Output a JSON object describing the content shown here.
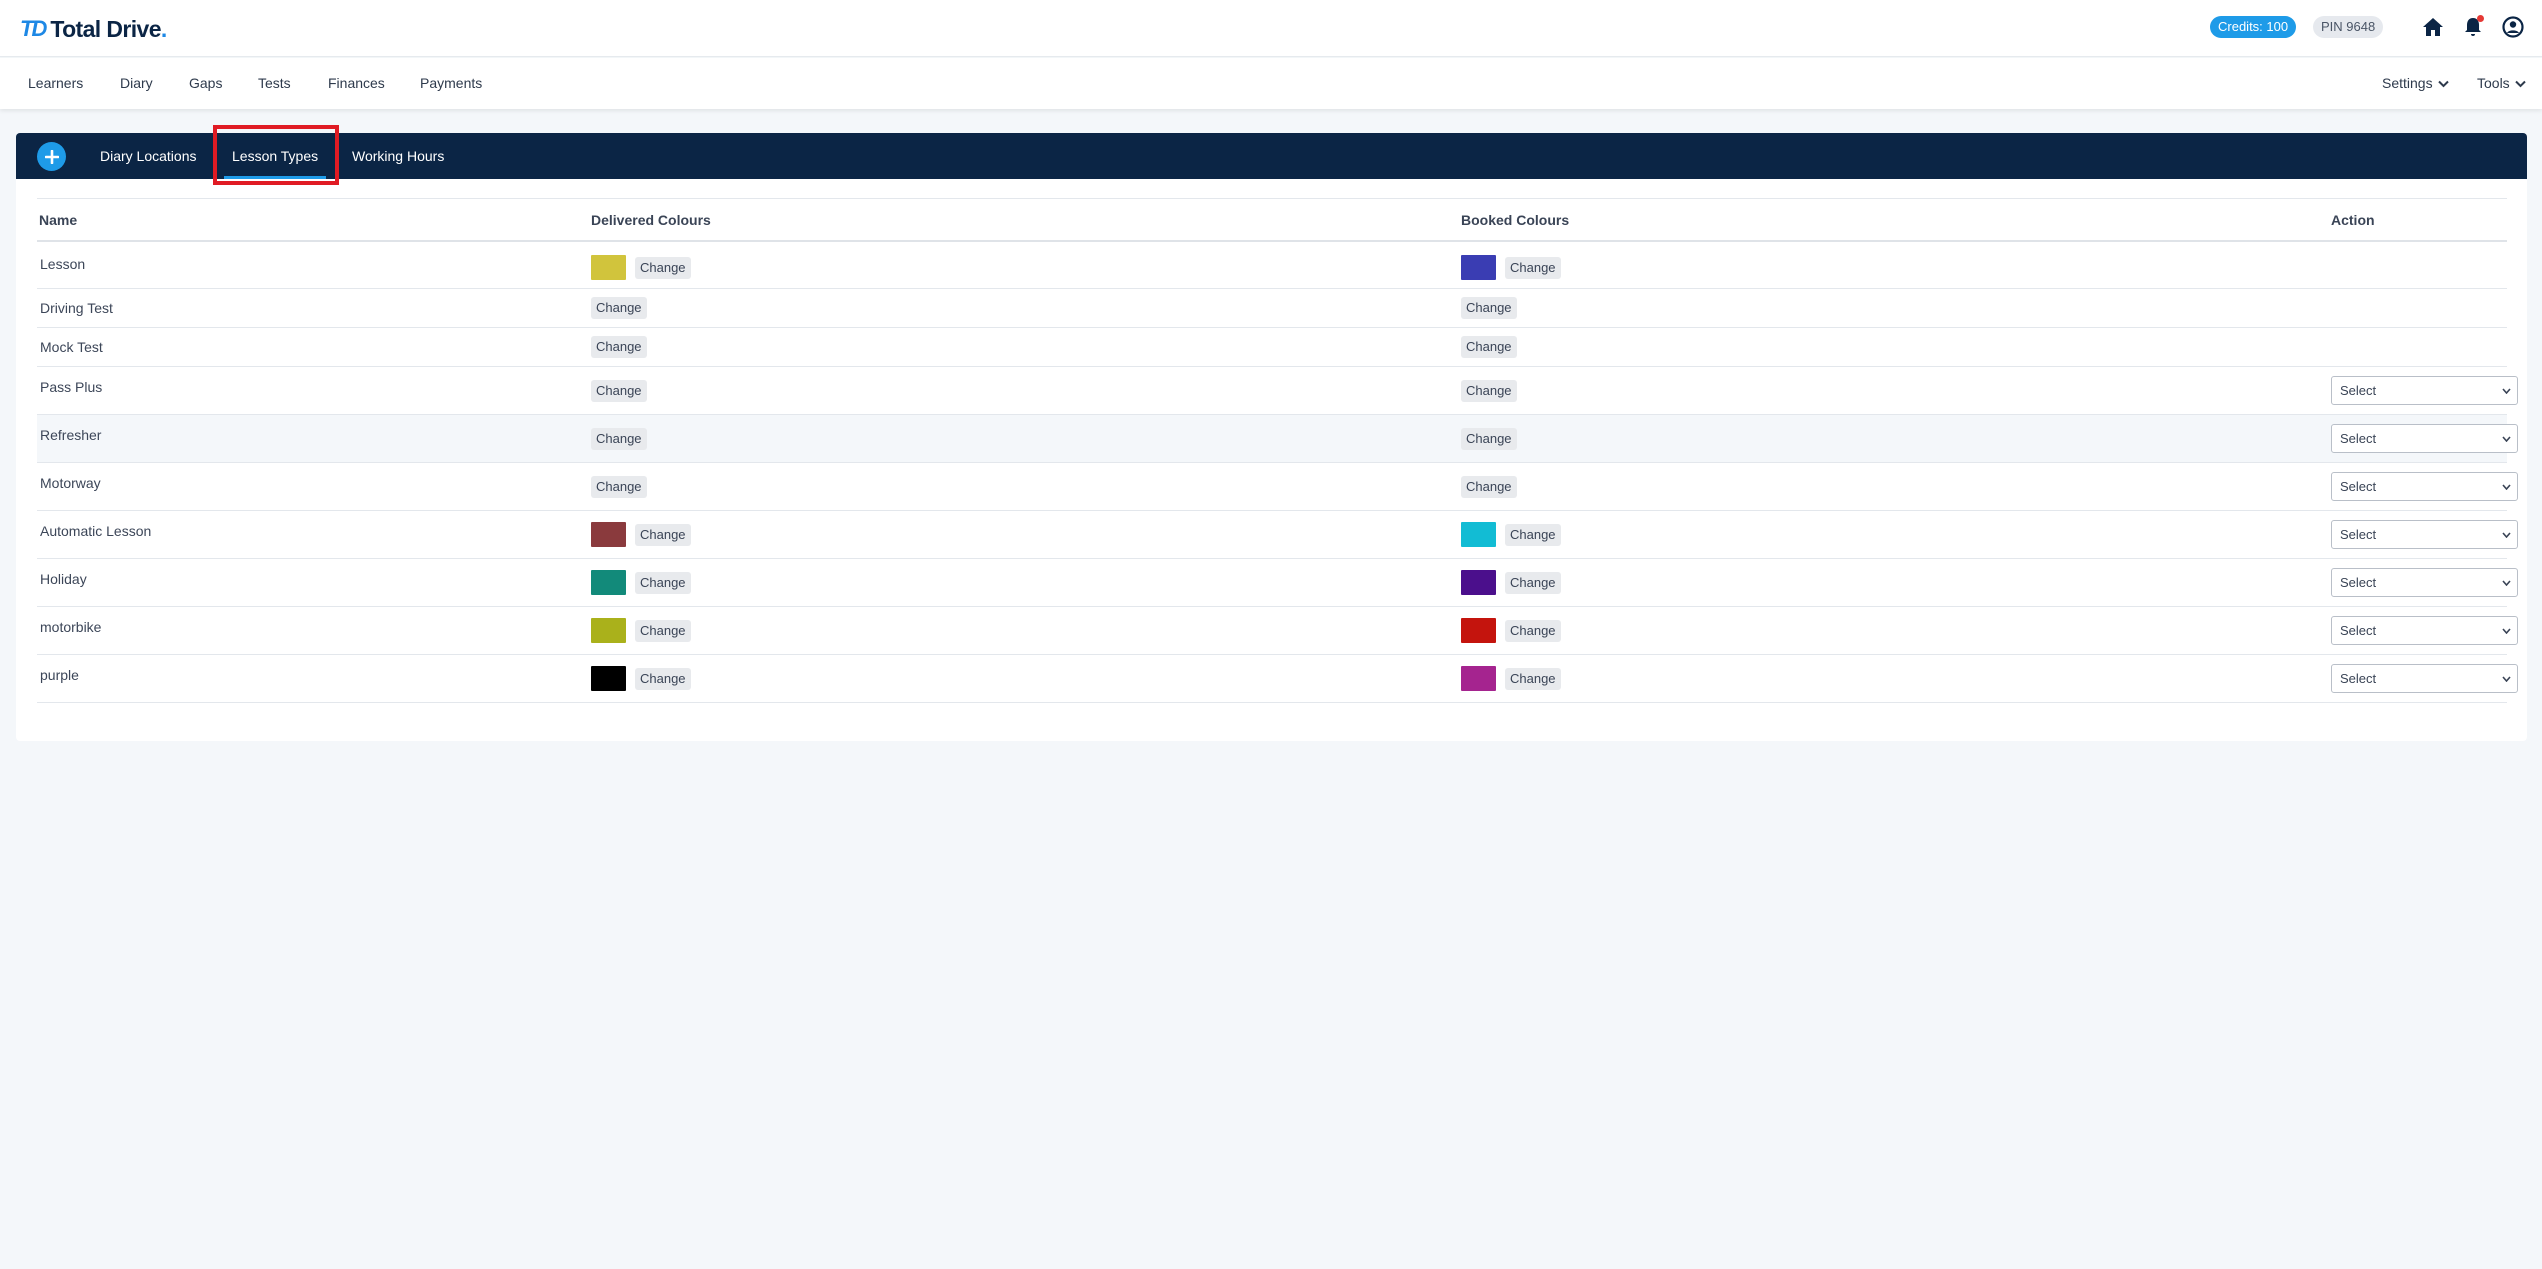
{
  "brand": {
    "mark": "TD",
    "name": "Total Drive",
    "accent": "#1e88e5",
    "navy": "#0b2545"
  },
  "header": {
    "credits": "Credits: 100",
    "pin": "PIN 9648",
    "icons": [
      "home-icon",
      "bell-icon",
      "user-circle-icon"
    ]
  },
  "nav": {
    "items": [
      "Learners",
      "Diary",
      "Gaps",
      "Tests",
      "Finances",
      "Payments"
    ],
    "settings": "Settings",
    "tools": "Tools"
  },
  "tabs": {
    "items": [
      "Diary Locations",
      "Lesson Types",
      "Working Hours"
    ],
    "active": "Lesson Types"
  },
  "table": {
    "headers": {
      "name": "Name",
      "delivered": "Delivered Colours",
      "booked": "Booked Colours",
      "action": "Action"
    },
    "change_label": "Change",
    "select_label": "Select",
    "rows": [
      {
        "name": "Lesson",
        "delivered": "#d1c43c",
        "booked": "#3a3db3",
        "has_action": false
      },
      {
        "name": "Driving Test",
        "delivered": null,
        "booked": null,
        "has_action": false
      },
      {
        "name": "Mock Test",
        "delivered": null,
        "booked": null,
        "has_action": false
      },
      {
        "name": "Pass Plus",
        "delivered": null,
        "booked": null,
        "has_action": true
      },
      {
        "name": "Refresher",
        "delivered": null,
        "booked": null,
        "has_action": true
      },
      {
        "name": "Motorway",
        "delivered": null,
        "booked": null,
        "has_action": true
      },
      {
        "name": "Automatic Lesson",
        "delivered": "#8a3a3d",
        "booked": "#12bcd4",
        "has_action": true
      },
      {
        "name": "Holiday",
        "delivered": "#128a7a",
        "booked": "#4b0f8c",
        "has_action": true
      },
      {
        "name": "motorbike",
        "delivered": "#aab11b",
        "booked": "#c4140d",
        "has_action": true
      },
      {
        "name": "purple",
        "delivered": "#000000",
        "booked": "#a5248f",
        "has_action": true
      }
    ]
  }
}
